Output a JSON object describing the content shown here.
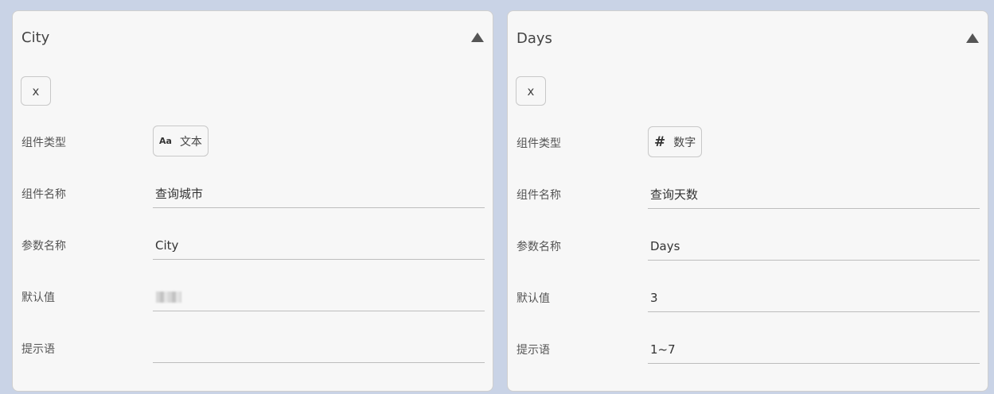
{
  "left_panel": {
    "title": "City",
    "remove_label": "x",
    "labels": {
      "component_type": "组件类型",
      "component_name": "组件名称",
      "param_name": "参数名称",
      "default_value": "默认值",
      "hint": "提示语"
    },
    "type": {
      "icon": "Aa",
      "label": "文本",
      "icon_name": "text-type-icon"
    },
    "component_name": "查询城市",
    "param_name": "City",
    "default_value": "",
    "hint": ""
  },
  "right_panel": {
    "title": "Days",
    "remove_label": "x",
    "labels": {
      "component_type": "组件类型",
      "component_name": "组件名称",
      "param_name": "参数名称",
      "default_value": "默认值",
      "hint": "提示语"
    },
    "type": {
      "icon": "#",
      "label": "数字",
      "icon_name": "number-type-icon"
    },
    "component_name": "查询天数",
    "param_name": "Days",
    "default_value": "3",
    "hint": "1~7"
  },
  "colors": {
    "page_background": "#c9d3e6",
    "panel_background": "#f7f7f7",
    "collapse_icon": "#555555"
  }
}
